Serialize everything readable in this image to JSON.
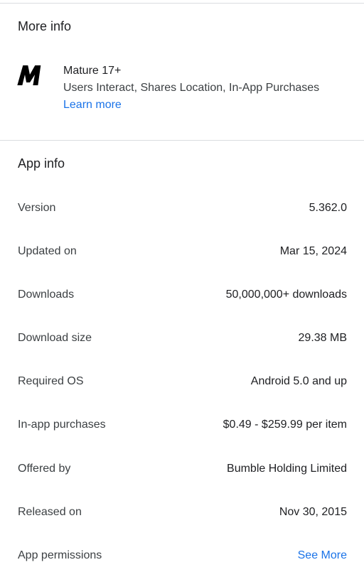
{
  "more_info": {
    "title": "More info",
    "rating_icon": "mature-rating-icon",
    "rating_name": "Mature 17+",
    "rating_descriptors": "Users Interact, Shares Location, In-App Purchases",
    "learn_more_label": "Learn more"
  },
  "app_info": {
    "title": "App info",
    "rows": [
      {
        "label": "Version",
        "value": "5.362.0"
      },
      {
        "label": "Updated on",
        "value": "Mar 15, 2024"
      },
      {
        "label": "Downloads",
        "value": "50,000,000+ downloads"
      },
      {
        "label": "Download size",
        "value": "29.38 MB"
      },
      {
        "label": "Required OS",
        "value": "Android 5.0 and up"
      },
      {
        "label": "In-app purchases",
        "value": "$0.49 - $259.99 per item"
      },
      {
        "label": "Offered by",
        "value": "Bumble Holding Limited"
      },
      {
        "label": "Released on",
        "value": "Nov 30, 2015"
      },
      {
        "label": "App permissions",
        "value": "See More"
      }
    ]
  },
  "colors": {
    "link": "#1a73e8",
    "divider": "#dadce0",
    "text_primary": "#202124",
    "text_secondary": "#3c4043"
  }
}
